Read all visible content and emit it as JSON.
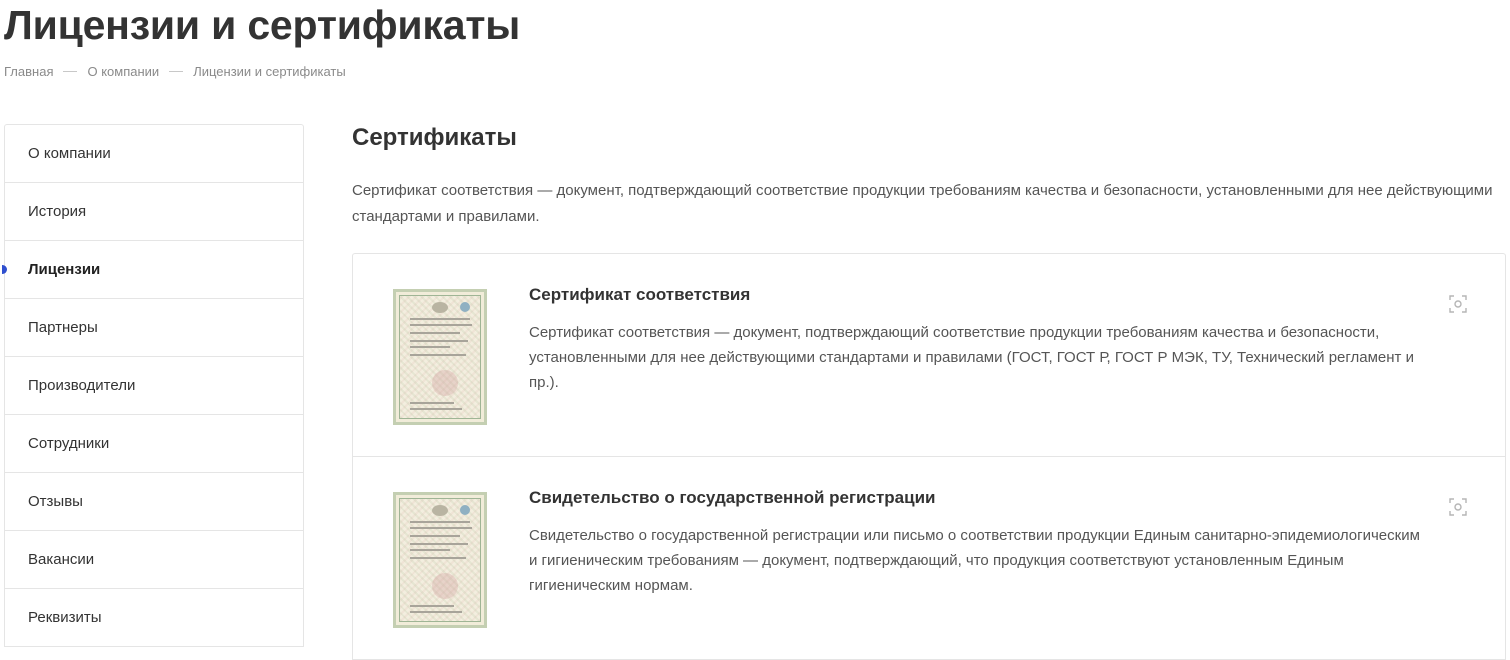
{
  "page": {
    "title": "Лицензии и сертификаты"
  },
  "breadcrumb": [
    "Главная",
    "О компании",
    "Лицензии и сертификаты"
  ],
  "sidebar": {
    "items": [
      {
        "label": "О компании"
      },
      {
        "label": "История"
      },
      {
        "label": "Лицензии",
        "active": true
      },
      {
        "label": "Партнеры"
      },
      {
        "label": "Производители"
      },
      {
        "label": "Сотрудники"
      },
      {
        "label": "Отзывы"
      },
      {
        "label": "Вакансии"
      },
      {
        "label": "Реквизиты"
      }
    ],
    "accent_color": "#2f4fcf"
  },
  "section": {
    "title": "Сертификаты",
    "description": "Сертификат соответствия — документ, подтверждающий соответствие продукции требованиям качества и безопасности, установленными для нее действующими стандартами и правилами."
  },
  "cards": [
    {
      "title": "Сертификат соответствия",
      "text": "Сертификат соответствия — документ, подтверждающий соответствие продукции требованиям качества и безопасности, установленными для нее действующими стандартами и правилами (ГОСТ, ГОСТ Р, ГОСТ Р МЭК, ТУ, Технический регламент и пр.).",
      "icon": "zoom-icon"
    },
    {
      "title": "Свидетельство о государственной регистрации",
      "text": "Свидетельство о государственной регистрации или письмо о соответствии продукции Единым санитарно-эпидемиологическим и гигиеническим требованиям — документ, подтверждающий, что продукция соответствуют установленным Единым гигиеническим нормам.",
      "icon": "zoom-icon"
    }
  ]
}
